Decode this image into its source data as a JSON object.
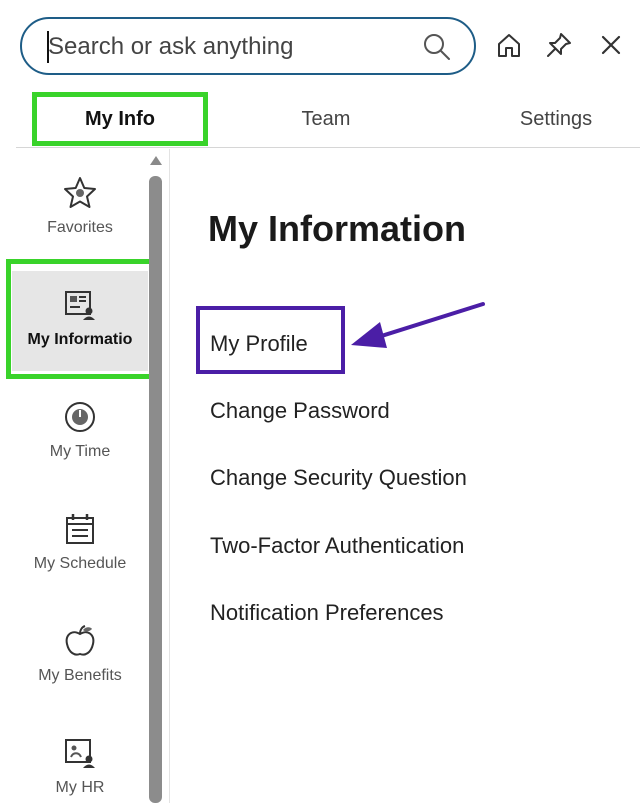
{
  "search": {
    "placeholder": "Search or ask anything"
  },
  "toolbar": {
    "icons": [
      "search-icon",
      "home-icon",
      "pin-icon",
      "close-icon"
    ]
  },
  "tabs": [
    {
      "label": "My Info",
      "active": true
    },
    {
      "label": "Team",
      "active": false
    },
    {
      "label": "Settings",
      "active": false
    }
  ],
  "sidebar": {
    "items": [
      {
        "label": "Favorites",
        "icon": "star-icon",
        "active": false
      },
      {
        "label": "My Informatio",
        "icon": "id-card-icon",
        "active": true
      },
      {
        "label": "My Time",
        "icon": "clock-icon",
        "active": false
      },
      {
        "label": "My Schedule",
        "icon": "calendar-icon",
        "active": false
      },
      {
        "label": "My Benefits",
        "icon": "apple-icon",
        "active": false
      },
      {
        "label": "My HR",
        "icon": "hr-document-icon",
        "active": false
      }
    ]
  },
  "main": {
    "title": "My Information",
    "links": [
      {
        "label": "My Profile"
      },
      {
        "label": "Change Password"
      },
      {
        "label": "Change Security Question"
      },
      {
        "label": "Two-Factor Authentication"
      },
      {
        "label": "Notification Preferences"
      }
    ]
  },
  "colors": {
    "search_border": "#1e5d87",
    "tab_highlight": "#39d32a",
    "annotation": "#4b1ea6",
    "active_item_bg": "#e6e6e6"
  }
}
